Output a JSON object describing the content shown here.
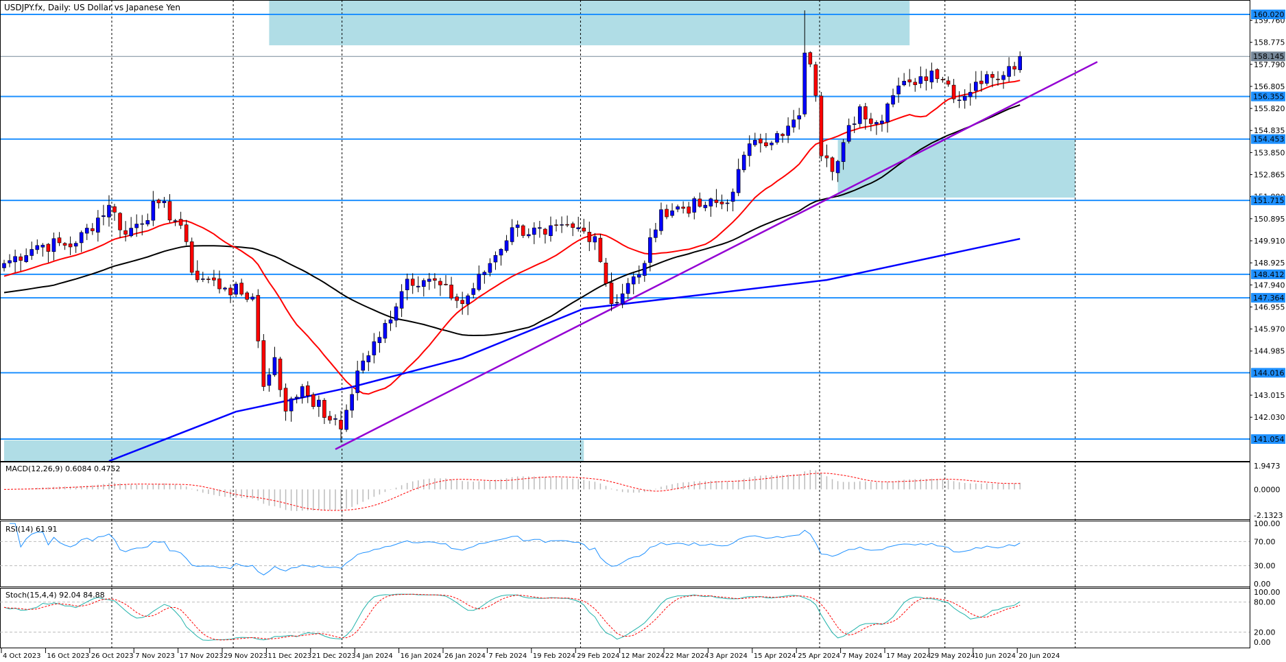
{
  "header": {
    "title": "USDJPY.fx, Daily:  US Dollar vs Japanese Yen"
  },
  "indicators": {
    "macd_label": "MACD(12,26,9) 0.6084 0.4752",
    "rsi_label": "RSI(14) 61.91",
    "stoch_label": "Stoch(15,4,4) 92.04 84.88"
  },
  "colors": {
    "bull": "#0000ff",
    "bear": "#ff0000",
    "hline": "#1e90ff",
    "zone": "#b0dde6",
    "ma_fast": "#ff0000",
    "ma_mid": "#000000",
    "ma_slow": "#0000ff",
    "trend": "#9400d3",
    "rsi": "#1e90ff",
    "stoch_main": "#20b2aa",
    "stoch_signal": "#ff0000",
    "bid": "#778899"
  },
  "chart_data": {
    "type": "candlestick",
    "symbol": "USDJPY.fx",
    "timeframe": "Daily",
    "ylim": [
      140.07,
      160.66
    ],
    "price_ticks": [
      "159.760",
      "158.775",
      "157.790",
      "156.805",
      "155.820",
      "154.835",
      "153.850",
      "152.865",
      "151.880",
      "150.895",
      "149.910",
      "148.925",
      "147.940",
      "146.955",
      "145.970",
      "144.985",
      "143.015",
      "142.030"
    ],
    "horizontal_levels": [
      "160.020",
      "156.355",
      "154.453",
      "151.715",
      "148.412",
      "147.364",
      "144.016",
      "141.054"
    ],
    "bid_level": "158.145",
    "date_labels": [
      "4 Oct 2023",
      "16 Oct 2023",
      "26 Oct 2023",
      "7 Nov 2023",
      "17 Nov 2023",
      "29 Nov 2023",
      "11 Dec 2023",
      "21 Dec 2023",
      "4 Jan 2024",
      "16 Jan 2024",
      "26 Jan 2024",
      "7 Feb 2024",
      "19 Feb 2024",
      "29 Feb 2024",
      "12 Mar 2024",
      "22 Mar 2024",
      "3 Apr 2024",
      "15 Apr 2024",
      "25 Apr 2024",
      "7 May 2024",
      "17 May 2024",
      "29 May 2024",
      "10 Jun 2024",
      "20 Jun 2024"
    ],
    "bars_per_date_label": 8,
    "separator_bars": [
      19.5,
      41.5,
      61.2,
      104.4,
      147.7,
      170.4,
      194
    ],
    "close_keypoints": [
      [
        0,
        148.9
      ],
      [
        6,
        149.7
      ],
      [
        13,
        149.8
      ],
      [
        19,
        151.5
      ],
      [
        22,
        150.2
      ],
      [
        28,
        151.6
      ],
      [
        32,
        150.6
      ],
      [
        34,
        148.5
      ],
      [
        40,
        147.8
      ],
      [
        45,
        147.4
      ],
      [
        47,
        143.4
      ],
      [
        49,
        144.7
      ],
      [
        51,
        142.3
      ],
      [
        54,
        143.4
      ],
      [
        59,
        141.9
      ],
      [
        61,
        141.5
      ],
      [
        64,
        144.1
      ],
      [
        68,
        145.6
      ],
      [
        73,
        148.2
      ],
      [
        77,
        148.2
      ],
      [
        83,
        147.1
      ],
      [
        88,
        148.9
      ],
      [
        92,
        150.5
      ],
      [
        98,
        150.2
      ],
      [
        103,
        150.5
      ],
      [
        107,
        150.1
      ],
      [
        110,
        147.1
      ],
      [
        115,
        148.4
      ],
      [
        118,
        150.4
      ],
      [
        119,
        151.3
      ],
      [
        127,
        151.5
      ],
      [
        131,
        151.6
      ],
      [
        133,
        153.1
      ],
      [
        136,
        154.4
      ],
      [
        141,
        154.6
      ],
      [
        144,
        155.5
      ],
      [
        145,
        158.3
      ],
      [
        146,
        157.8
      ],
      [
        147,
        156.4
      ],
      [
        148,
        153.7
      ],
      [
        150,
        153.0
      ],
      [
        152,
        154.3
      ],
      [
        155,
        155.9
      ],
      [
        158,
        155.2
      ],
      [
        161,
        156.4
      ],
      [
        164,
        157.0
      ],
      [
        168,
        157.5
      ],
      [
        171,
        156.9
      ],
      [
        173,
        156.2
      ],
      [
        176,
        157.0
      ],
      [
        179,
        157.2
      ],
      [
        182,
        157.7
      ],
      [
        184,
        158.145
      ]
    ],
    "ma_slow_keypoints": [
      [
        19,
        140.07
      ],
      [
        42,
        142.28
      ],
      [
        63,
        143.38
      ],
      [
        83,
        144.67
      ],
      [
        105,
        146.88
      ],
      [
        149,
        148.16
      ],
      [
        184,
        150.0
      ]
    ],
    "trendline": [
      [
        60,
        140.6
      ],
      [
        198,
        157.9
      ]
    ],
    "zones": [
      {
        "from_bar": 48,
        "to_bar": 164,
        "top": 160.66,
        "bottom": 158.64
      },
      {
        "from_bar": 151,
        "to_bar": 194,
        "top": 154.41,
        "bottom": 151.84
      },
      {
        "from_bar": 0,
        "to_bar": 105,
        "top": 141.0,
        "bottom": 140.07
      }
    ],
    "macd_ticks": [
      "1.9473",
      "0.0000",
      "-2.1323"
    ],
    "macd_range": [
      -2.1323,
      1.9473
    ],
    "rsi_ticks": [
      "100.00",
      "70.00",
      "30.00",
      "0.00"
    ],
    "stoch_ticks": [
      "100.00",
      "80.00",
      "20.00",
      "0.00"
    ]
  }
}
